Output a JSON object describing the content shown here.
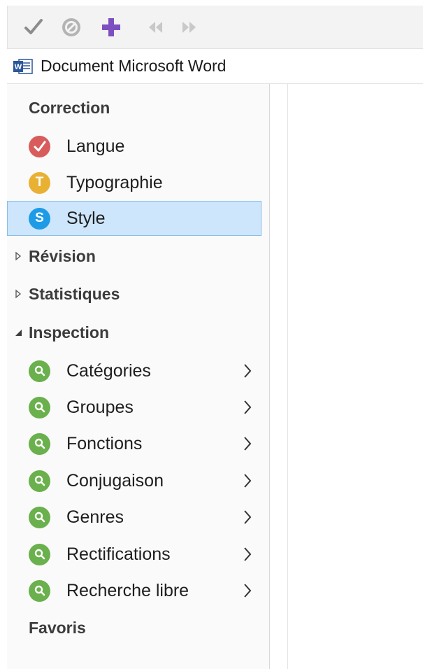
{
  "toolbar": {
    "buttons": [
      {
        "name": "check-icon",
        "color": "#8c8c8c"
      },
      {
        "name": "ban-icon",
        "color": "#b4b4b4"
      },
      {
        "name": "plus-icon",
        "color": "#7d4fc1"
      },
      {
        "name": "rewind-icon",
        "color": "#c8c8c8"
      },
      {
        "name": "fast-forward-icon",
        "color": "#c8c8c8"
      }
    ]
  },
  "document": {
    "icon": "word-icon",
    "title": "Document Microsoft Word"
  },
  "sidebar": {
    "correction": {
      "title": "Correction",
      "items": [
        {
          "label": "Langue",
          "icon": "check-badge-icon",
          "color": "#d85c5c",
          "glyph": "✓"
        },
        {
          "label": "Typographie",
          "icon": "t-badge-icon",
          "color": "#e9b134",
          "glyph": "T"
        },
        {
          "label": "Style",
          "icon": "s-badge-icon",
          "color": "#1e9be6",
          "glyph": "S",
          "selected": true
        }
      ]
    },
    "revision": {
      "title": "Révision",
      "expanded": false
    },
    "statistiques": {
      "title": "Statistiques",
      "expanded": false
    },
    "inspection": {
      "title": "Inspection",
      "expanded": true,
      "items": [
        {
          "label": "Catégories",
          "icon": "magnifier-badge-icon",
          "color": "#6ab04c"
        },
        {
          "label": "Groupes",
          "icon": "magnifier-badge-icon",
          "color": "#6ab04c"
        },
        {
          "label": "Fonctions",
          "icon": "magnifier-badge-icon",
          "color": "#6ab04c"
        },
        {
          "label": "Conjugaison",
          "icon": "magnifier-badge-icon",
          "color": "#6ab04c"
        },
        {
          "label": "Genres",
          "icon": "magnifier-badge-icon",
          "color": "#6ab04c"
        },
        {
          "label": "Rectifications",
          "icon": "magnifier-badge-icon",
          "color": "#6ab04c"
        },
        {
          "label": "Recherche libre",
          "icon": "magnifier-badge-icon",
          "color": "#6ab04c"
        }
      ]
    },
    "favoris": {
      "title": "Favoris"
    }
  }
}
